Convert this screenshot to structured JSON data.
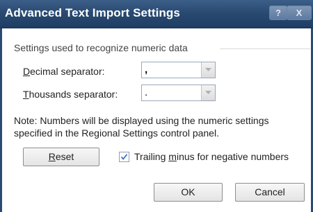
{
  "window": {
    "title": "Advanced Text Import Settings",
    "help_glyph": "?",
    "close_glyph": "X"
  },
  "group": {
    "label": "Settings used to recognize numeric data"
  },
  "decimal": {
    "label_prefix": "D",
    "label_rest": "ecimal separator:",
    "value": ","
  },
  "thousands": {
    "label_prefix": "T",
    "label_rest": "housands separator:",
    "value": "."
  },
  "note": {
    "text": "Note: Numbers will be displayed using the numeric settings specified in the Regional Settings control panel."
  },
  "reset": {
    "label_prefix": "R",
    "label_rest": "eset"
  },
  "trailing_minus": {
    "checked": true,
    "label_before": "Trailing ",
    "label_underlined": "m",
    "label_after": "inus for negative numbers"
  },
  "buttons": {
    "ok": "OK",
    "cancel": "Cancel"
  }
}
